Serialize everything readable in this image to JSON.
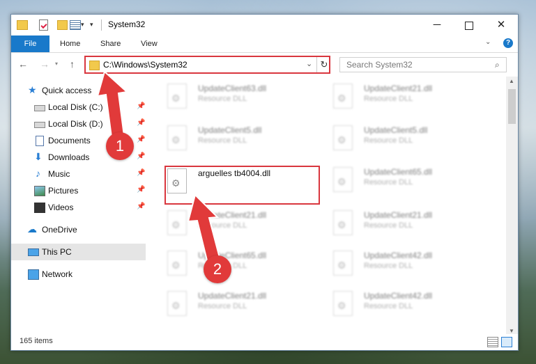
{
  "window": {
    "title": "System32",
    "controls": {
      "minimize": "─",
      "close": "✕"
    }
  },
  "quick_access_toolbar": {
    "dropdown_glyph": "▾",
    "customize_glyph": "▾"
  },
  "ribbon": {
    "tabs": [
      "File",
      "Home",
      "Share",
      "View"
    ],
    "expand_glyph": "⌄",
    "help_glyph": "?"
  },
  "navigation": {
    "back_glyph": "←",
    "forward_glyph": "→",
    "recent_glyph": "▾",
    "up_glyph": "↑",
    "address": "C:\\Windows\\System32",
    "address_dropdown_glyph": "⌄",
    "refresh_glyph": "↻",
    "search_placeholder": "Search System32",
    "search_glyph": "⌕"
  },
  "sidebar": {
    "items": [
      {
        "label": "Quick access",
        "pinned": false,
        "icon": "star-icon"
      },
      {
        "label": "Local Disk (C:)",
        "pinned": true,
        "icon": "disk-icon"
      },
      {
        "label": "Local Disk (D:)",
        "pinned": true,
        "icon": "disk-icon"
      },
      {
        "label": "Documents",
        "pinned": true,
        "icon": "documents-icon"
      },
      {
        "label": "Downloads",
        "pinned": true,
        "icon": "downloads-icon"
      },
      {
        "label": "Music",
        "pinned": true,
        "icon": "music-icon"
      },
      {
        "label": "Pictures",
        "pinned": true,
        "icon": "pictures-icon"
      },
      {
        "label": "Videos",
        "pinned": true,
        "icon": "videos-icon"
      },
      {
        "label": "OneDrive",
        "pinned": false,
        "icon": "onedrive-icon"
      },
      {
        "label": "This PC",
        "pinned": false,
        "icon": "computer-icon",
        "selected": true
      },
      {
        "label": "Network",
        "pinned": false,
        "icon": "network-icon"
      }
    ],
    "pin_glyph": "📌"
  },
  "files": {
    "left_column": [
      {
        "name": "UpdateClient63.dll",
        "type": "Resource DLL"
      },
      {
        "name": "UpdateClient5.dll",
        "type": "Resource DLL"
      },
      {
        "name": "arguelles tb4004.dll",
        "type": "",
        "highlighted": true
      },
      {
        "name": "UpdateClient21.dll",
        "type": "Resource DLL"
      },
      {
        "name": "UpdateClient65.dll",
        "type": "Resource DLL"
      },
      {
        "name": "UpdateClient21.dll",
        "type": "Resource DLL"
      }
    ],
    "right_column": [
      {
        "name": "UpdateClient21.dll",
        "type": "Resource DLL"
      },
      {
        "name": "UpdateClient5.dll",
        "type": "Resource DLL"
      },
      {
        "name": "UpdateClient65.dll",
        "type": "Resource DLL"
      },
      {
        "name": "UpdateClient21.dll",
        "type": "Resource DLL"
      },
      {
        "name": "UpdateClient42.dll",
        "type": "Resource DLL"
      },
      {
        "name": "UpdateClient42.dll",
        "type": "Resource DLL"
      }
    ]
  },
  "scrollbar": {
    "up_glyph": "▲",
    "down_glyph": "▼"
  },
  "status": {
    "item_count": "165 items"
  },
  "callouts": [
    "1",
    "2"
  ],
  "colors": {
    "accent": "#1979ca",
    "highlight": "#d9363e",
    "callout": "#e13a3a"
  }
}
